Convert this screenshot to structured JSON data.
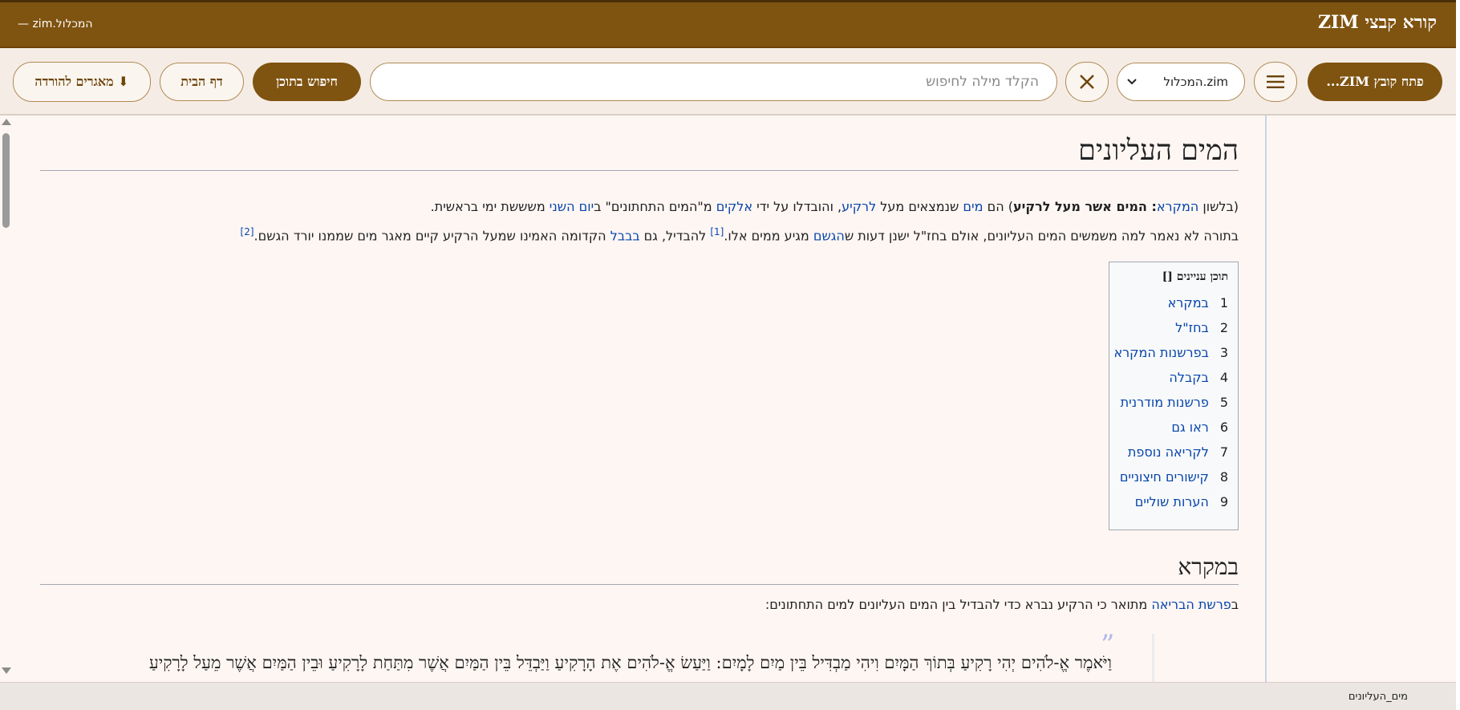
{
  "titlebar": {
    "app_title": "קורא קבצי ZIM",
    "doc_name": "המכלול.zim —"
  },
  "toolbar": {
    "open_zim_label": "פתח קובץ ZIM...",
    "menu_icon": "hamburger-icon",
    "archive_select_value": "המכלול.zim",
    "clear_icon": "close-icon",
    "search_placeholder": "הקלד מילה לחיפוש",
    "search_in_content_label": "חיפוש בתוכן",
    "home_label": "דף הבית",
    "download_repos_label": "⬇ מאגרים להורדה"
  },
  "article": {
    "title": "המים העליונים",
    "p1": {
      "open": "(בלשון ",
      "link_mikra": "המקרא",
      "quote": ": המים אשר מעל לרקיע",
      "mid1": ") הם ",
      "link_mayim": "מים",
      "mid2": " שנמצאים מעל ",
      "link_rakia": "לרקיע",
      "mid3": ", והובדלו על ידי ",
      "link_elokim": "אלקים",
      "mid4": " מ\"המים התחתונים\" ב",
      "link_yom": "יום השני",
      "end": " משששת ימי בראשית."
    },
    "p2": {
      "start": "בתורה לא נאמר למה משמשים המים העליונים, אולם בחז\"ל ישנן דעות ש",
      "link_geshem": "הגשם",
      "mid1": " מגיע ממים אלו.",
      "ref1": "[1]",
      "mid2": " להבדיל, גם ",
      "link_bavel": "בבבל",
      "mid3": " הקדומה האמינו שמעל הרקיע קיים מאגר מים שממנו יורד הגשם.",
      "ref2": "[2]"
    },
    "toc": {
      "title": "תוכן עניינים []",
      "items": [
        {
          "num": "1",
          "label": "במקרא"
        },
        {
          "num": "2",
          "label": "בחז\"ל"
        },
        {
          "num": "3",
          "label": "בפרשנות המקרא"
        },
        {
          "num": "4",
          "label": "בקבלה"
        },
        {
          "num": "5",
          "label": "פרשנות מודרנית"
        },
        {
          "num": "6",
          "label": "ראו גם"
        },
        {
          "num": "7",
          "label": "לקריאה נוספת"
        },
        {
          "num": "8",
          "label": "קישורים חיצוניים"
        },
        {
          "num": "9",
          "label": "הערות שוליים"
        }
      ]
    },
    "section1_title": "במקרא",
    "p3": {
      "start": "ב",
      "link_parasha": "פרשת הבריאה",
      "end": " מתואר כי הרקיע נברא כדי להבדיל בין המים העליונים למים התחתונים:"
    },
    "quote_mark": "”",
    "quote_text": "וַיֹּאמֶר אֱ-לֹהִים יְהִי רָקִיעַ בְּתוֹךְ הַמָּיִם וִיהִי מַבְדִּיל בֵּין מַיִם לָמָיִם: וַיַּעַשׂ אֱ-לֹהִים אֶת הָרָקִיעַ וַיַּבְדֵּל בֵּין הַמַּיִם אֲשֶׁר מִתַּחַת לָרָקִיעַ וּבֵין הַמַּיִם אֲשֶׁר מֵעַל לָרָקִיעַ"
  },
  "statusbar": {
    "page_name": "מים_העליונים"
  }
}
